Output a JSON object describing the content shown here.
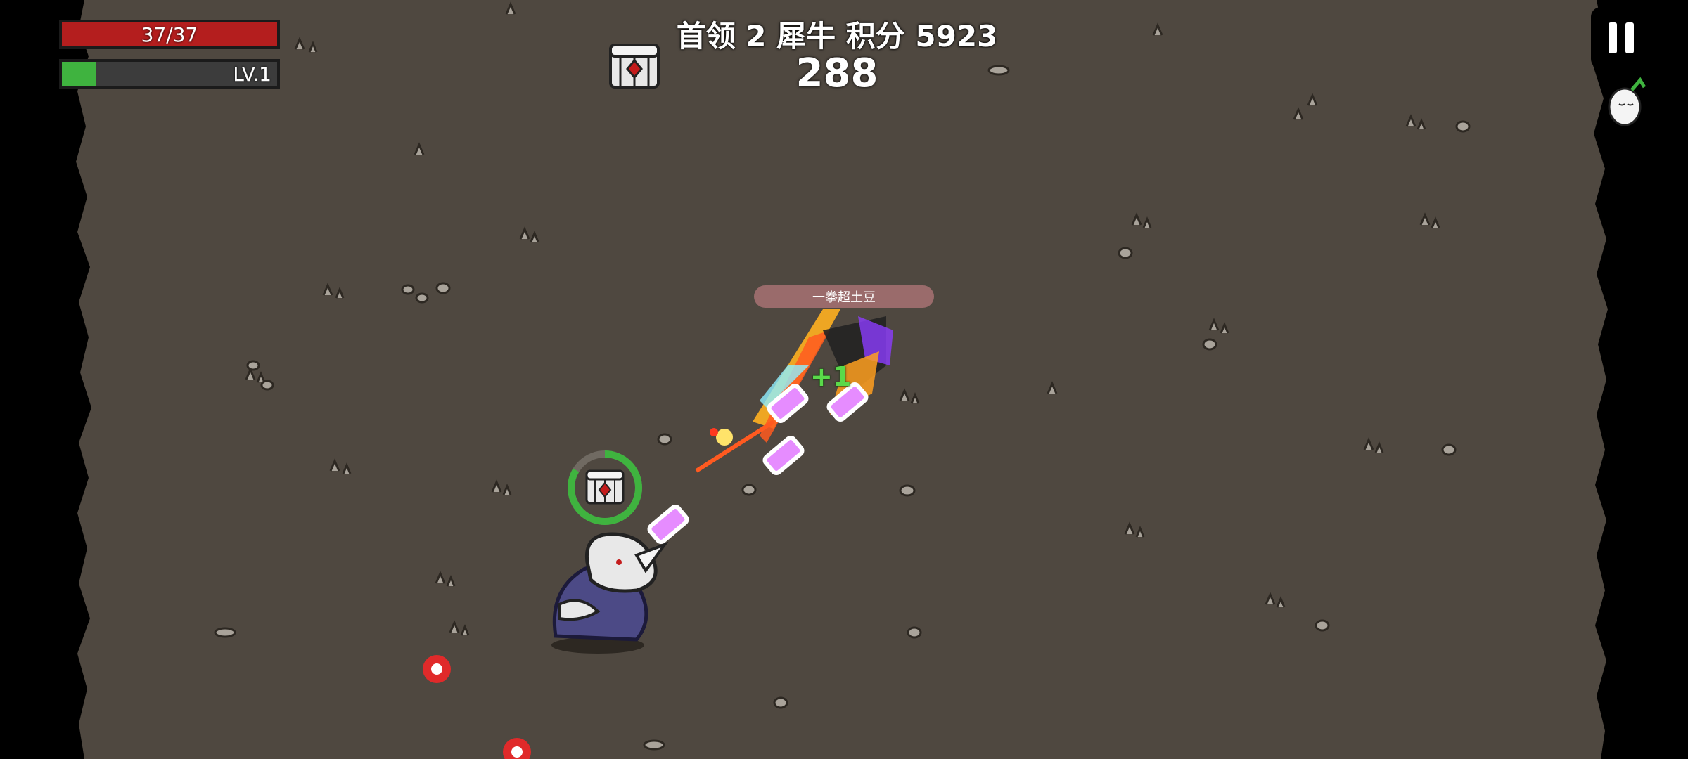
{
  "hud": {
    "hp_text": "37/37",
    "hp_fraction": 1.0,
    "level_text": "LV.1",
    "xp_fraction": 0.16
  },
  "boss": {
    "title": "首领 2  犀牛  积分 5923",
    "timer": "288",
    "nameplate": "一拳超土豆"
  },
  "floating_text": "+1",
  "icons": {
    "pause": "pause-icon",
    "player": "egg-player-icon",
    "chest": "treasure-chest-icon"
  },
  "colors": {
    "ground": "#4f4840",
    "hp": "#b41e1e",
    "xp": "#3fb33f",
    "projectile": "#e68cff"
  }
}
